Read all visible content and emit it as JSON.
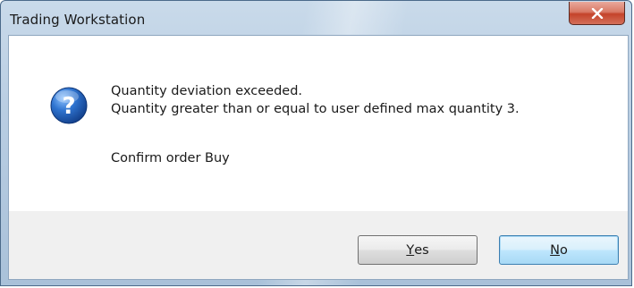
{
  "window": {
    "title": "Trading Workstation",
    "close_icon": "close-x-icon"
  },
  "dialog": {
    "icon": "question-icon",
    "icon_glyph": "?",
    "message_line1": "Quantity deviation exceeded.",
    "message_line2": "Quantity greater than or equal to user defined max quantity 3.",
    "message_line3": "Confirm order Buy"
  },
  "buttons": {
    "yes": {
      "mnemonic": "Y",
      "rest": "es"
    },
    "no": {
      "mnemonic": "N",
      "rest": "o"
    }
  },
  "colors": {
    "close_button": "#c4432a",
    "icon_blue": "#1f5fb5",
    "default_button_border": "#3c7fb1"
  }
}
